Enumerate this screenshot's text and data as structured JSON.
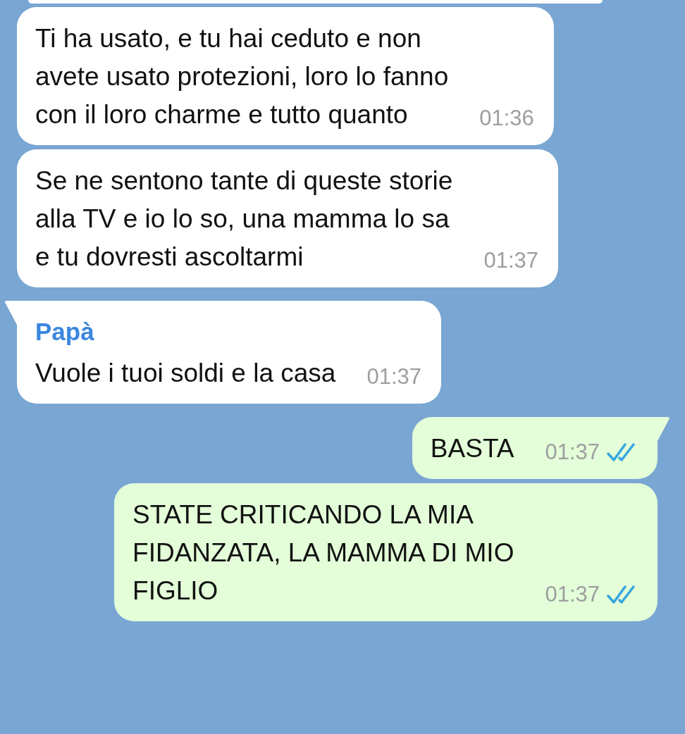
{
  "messages": [
    {
      "kind": "incoming",
      "tail": false,
      "text": "Ti ha usato, e tu hai ceduto e non\navete usato protezioni, loro lo fanno\ncon il loro charme e tutto quanto",
      "time": "01:36"
    },
    {
      "kind": "incoming",
      "tail": false,
      "text": "Se ne sentono tante di queste storie\nalla TV e io lo so, una mamma lo sa\ne tu dovresti ascoltarmi",
      "time": "01:37"
    },
    {
      "kind": "incoming",
      "tail": true,
      "sender": "Papà",
      "text": "Vuole i tuoi soldi e la casa",
      "time": "01:37"
    },
    {
      "kind": "outgoing",
      "tail": true,
      "text": "BASTA",
      "time": "01:37",
      "read": true
    },
    {
      "kind": "outgoing",
      "tail": false,
      "text": "STATE CRITICANDO LA MIA\nFIDANZATA, LA MAMMA DI MIO\nFIGLIO",
      "time": "01:37",
      "read": true
    }
  ]
}
